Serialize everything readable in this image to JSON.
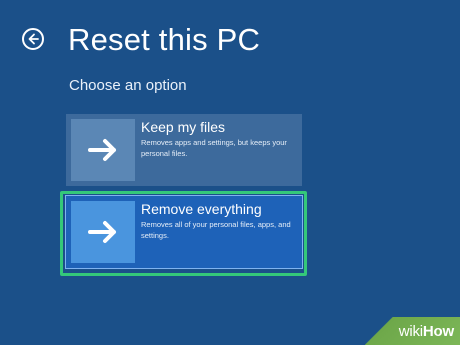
{
  "header": {
    "title": "Reset this PC",
    "back_icon": "back-arrow-circle-icon"
  },
  "subtitle": "Choose an option",
  "options": [
    {
      "label": "Keep my files",
      "description": "Removes apps and settings, but keeps your personal files.",
      "icon": "arrow-right-icon",
      "selected": false
    },
    {
      "label": "Remove everything",
      "description": "Removes all of your personal files, apps, and settings.",
      "icon": "arrow-right-icon",
      "selected": true
    }
  ],
  "watermark": {
    "prefix": "wiki",
    "suffix": "How"
  },
  "colors": {
    "background": "#1b5089",
    "highlight": "#34c87a",
    "watermark_green": "#7cb657"
  }
}
